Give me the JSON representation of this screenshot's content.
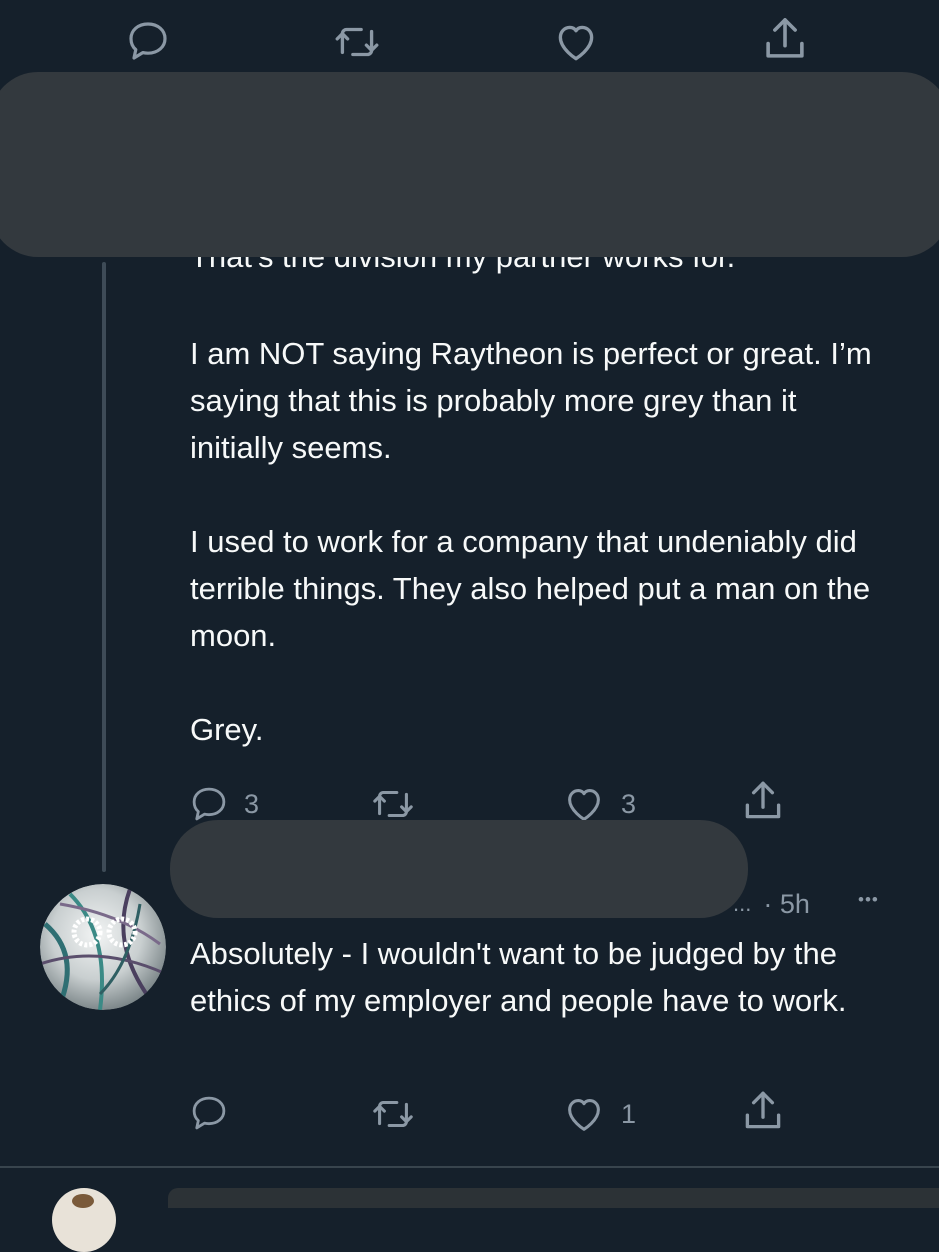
{
  "prev_tweet": {
    "partial_text": "That's the division my partner works for."
  },
  "tweet": {
    "paragraphs": [
      "I am NOT saying Raytheon is perfect or great. I’m saying that this is probably more grey than it initially seems.",
      "I used to work for a company that undeniably did terrible things. They also helped put a man on the moon.",
      "Grey."
    ],
    "actions": {
      "reply_count": "3",
      "retweet_count": "",
      "like_count": "3"
    }
  },
  "reply": {
    "handle_ellipsis": "...",
    "time": "· 5h",
    "more": "•••",
    "text": "Absolutely - I wouldn't want to be judged by the ethics of my employer and people have to work.",
    "actions": {
      "reply_count": "",
      "retweet_count": "",
      "like_count": "1"
    }
  },
  "colors": {
    "background": "#15202b",
    "text": "#f7f9f9",
    "muted": "#8b98a5",
    "redaction": "#33393e",
    "thread_line": "#3e4b57"
  }
}
